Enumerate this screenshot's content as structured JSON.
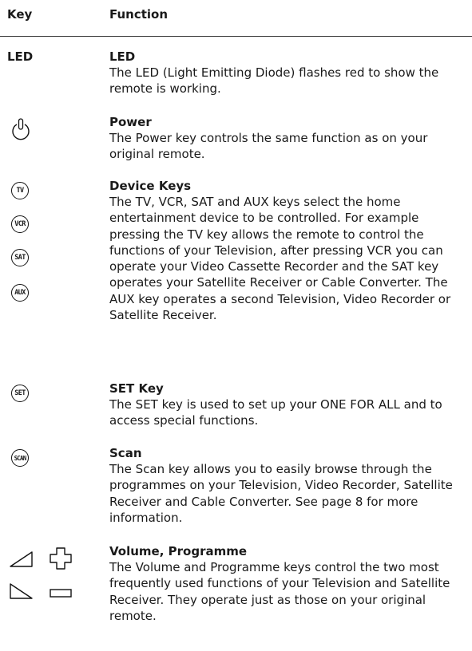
{
  "header": {
    "key": "Key",
    "function": "Function"
  },
  "rows": [
    {
      "key_text": "LED",
      "title": "LED",
      "desc": "The LED (Light Emitting Diode) flashes red to show the remote is working."
    },
    {
      "key_icon": "power-icon",
      "title": "Power",
      "desc": "The Power key controls the same function as on your original remote."
    },
    {
      "key_buttons": [
        "TV",
        "VCR",
        "SAT",
        "AUX"
      ],
      "title": "Device Keys",
      "desc": "The TV, VCR, SAT and AUX keys select the home entertainment device to be controlled. For example pressing the TV key allows the remote to control the functions of your Television, after pressing VCR you can operate your Video Cassette Recorder and the SAT key operates your Satellite Receiver or Cable Converter. The AUX key operates a second Television, Video Recorder or Satellite Receiver."
    },
    {
      "key_buttons": [
        "SET"
      ],
      "title": "SET Key",
      "desc": "The SET key is used to set up your ONE FOR ALL and to access special functions."
    },
    {
      "key_buttons": [
        "SCAN"
      ],
      "title": "Scan",
      "desc": "The Scan key allows you to easily browse through the programmes on your Television, Video Recorder, Satellite Receiver and Cable Converter. See page 8 for more information."
    },
    {
      "key_icons": [
        "volume-up-icon",
        "programme-up-icon",
        "volume-down-icon",
        "programme-down-icon"
      ],
      "title": "Volume, Programme",
      "desc": "The Volume and Programme keys control the two most frequently used functions of your Television and Satellite Receiver. They operate just as those on your original remote."
    }
  ]
}
